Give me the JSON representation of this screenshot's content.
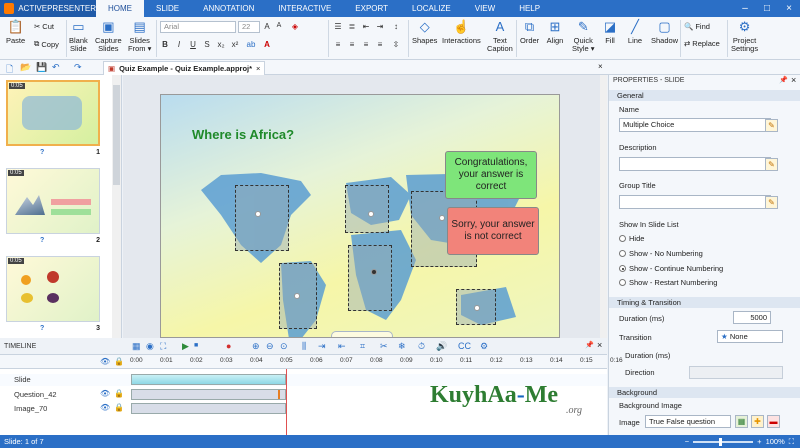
{
  "app": {
    "name": "ACTIVEPRESENTER"
  },
  "ribbon_tabs": [
    "HOME",
    "SLIDE",
    "ANNOTATION",
    "INTERACTIVE",
    "EXPORT",
    "LOCALIZE",
    "VIEW",
    "HELP"
  ],
  "ribbon": {
    "paste": "Paste",
    "cut": "Cut",
    "copy": "Copy",
    "blank_slide": [
      "Blank",
      "Slide"
    ],
    "capture_slides": [
      "Capture",
      "Slides"
    ],
    "slides_from": [
      "Slides",
      "From ▾"
    ],
    "font_name": "Arial",
    "font_size": "22",
    "shapes": "Shapes",
    "interactions": "Interactions",
    "text_caption": [
      "Text",
      "Caption"
    ],
    "order": "Order",
    "align": "Align",
    "quick_style": [
      "Quick",
      "Style ▾"
    ],
    "fill": "Fill",
    "line": "Line",
    "shadow": "Shadow",
    "find": "Find",
    "replace": "Replace",
    "project_settings": [
      "Project",
      "Settings"
    ]
  },
  "document_tab": "Quiz Example - Quiz Example.approj*",
  "slides": [
    {
      "duration": "0:05",
      "number": "1"
    },
    {
      "duration": "0:05",
      "number": "2"
    },
    {
      "duration": "0:05",
      "number": "3"
    }
  ],
  "slide": {
    "title": "Where is Africa?",
    "correct_msg": "Congratulations, your answer is correct",
    "incorrect_msg": "Sorry, your answer is not correct"
  },
  "properties": {
    "header": "PROPERTIES - SLIDE",
    "general": "General",
    "name_label": "Name",
    "name_value": "Multiple Choice",
    "description_label": "Description",
    "group_title_label": "Group Title",
    "show_in_list_label": "Show In Slide List",
    "radio_options": [
      "Hide",
      "Show - No Numbering",
      "Show - Continue Numbering",
      "Show - Restart Numbering"
    ],
    "radio_selected": 2,
    "timing_header": "Timing & Transition",
    "duration_label": "Duration (ms)",
    "duration_value": "5000",
    "transition_label": "Transition",
    "transition_value": "None",
    "trans_duration_label": "Duration (ms)",
    "direction_label": "Direction",
    "background_header": "Background",
    "background_image_label": "Background Image",
    "image_label": "Image",
    "image_value": "True False question"
  },
  "timeline": {
    "title": "TIMELINE",
    "ticks": [
      "0:00",
      "0:01",
      "0:02",
      "0:03",
      "0:04",
      "0:05",
      "0:06",
      "0:07",
      "0:08",
      "0:09",
      "0:10",
      "0:11",
      "0:12",
      "0:13",
      "0:14",
      "0:15",
      "0:16"
    ],
    "rows": [
      "Slide",
      "Question_42",
      "Image_70"
    ]
  },
  "watermark": {
    "main_a": "KuyhAa",
    "dash": "-",
    "main_b": "Me",
    "org": ".org"
  },
  "status": {
    "slide": "Slide: 1 of 7",
    "zoom": "100%"
  },
  "colors": {
    "accent": "#2b6fc6",
    "correct_bg": "#7ee57a",
    "incorrect_bg": "#f2837a",
    "title": "#1f8a2a"
  }
}
